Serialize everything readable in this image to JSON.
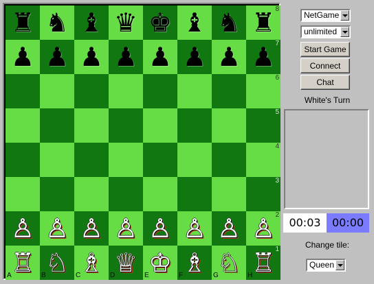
{
  "board": {
    "rank_labels": [
      "8",
      "7",
      "6",
      "5",
      "4",
      "3",
      "2",
      "1"
    ],
    "file_labels": [
      "A",
      "B",
      "C",
      "D",
      "E",
      "F",
      "G",
      "H"
    ],
    "ranks": [
      [
        [
          "b",
          "rook"
        ],
        [
          "b",
          "knight"
        ],
        [
          "b",
          "bishop"
        ],
        [
          "b",
          "queen"
        ],
        [
          "b",
          "king"
        ],
        [
          "b",
          "bishop"
        ],
        [
          "b",
          "knight"
        ],
        [
          "b",
          "rook"
        ]
      ],
      [
        [
          "b",
          "pawn"
        ],
        [
          "b",
          "pawn"
        ],
        [
          "b",
          "pawn"
        ],
        [
          "b",
          "pawn"
        ],
        [
          "b",
          "pawn"
        ],
        [
          "b",
          "pawn"
        ],
        [
          "b",
          "pawn"
        ],
        [
          "b",
          "pawn"
        ]
      ],
      [
        null,
        null,
        null,
        null,
        null,
        null,
        null,
        null
      ],
      [
        null,
        null,
        null,
        null,
        null,
        null,
        null,
        null
      ],
      [
        null,
        null,
        null,
        null,
        null,
        null,
        null,
        null
      ],
      [
        null,
        null,
        null,
        null,
        null,
        null,
        null,
        null
      ],
      [
        [
          "w",
          "pawn"
        ],
        [
          "w",
          "pawn"
        ],
        [
          "w",
          "pawn"
        ],
        [
          "w",
          "pawn"
        ],
        [
          "w",
          "pawn"
        ],
        [
          "w",
          "pawn"
        ],
        [
          "w",
          "pawn"
        ],
        [
          "w",
          "pawn"
        ]
      ],
      [
        [
          "w",
          "rook"
        ],
        [
          "w",
          "knight"
        ],
        [
          "w",
          "bishop"
        ],
        [
          "w",
          "queen"
        ],
        [
          "w",
          "king"
        ],
        [
          "w",
          "bishop"
        ],
        [
          "w",
          "knight"
        ],
        [
          "w",
          "rook"
        ]
      ]
    ],
    "colors": {
      "light": "#66dd44",
      "dark": "#117711"
    }
  },
  "controls": {
    "mode_select": "NetGame",
    "time_select": "unlimited",
    "start_game_label": "Start Game",
    "connect_label": "Connect",
    "chat_label": "Chat",
    "turn_status": "White's Turn",
    "white_clock": "00:03",
    "black_clock": "00:00",
    "change_tile_label": "Change tile:",
    "tile_select": "Queen"
  },
  "colors": {
    "white_clock_bg": "#ffffff",
    "black_clock_bg": "#7b7bff"
  }
}
